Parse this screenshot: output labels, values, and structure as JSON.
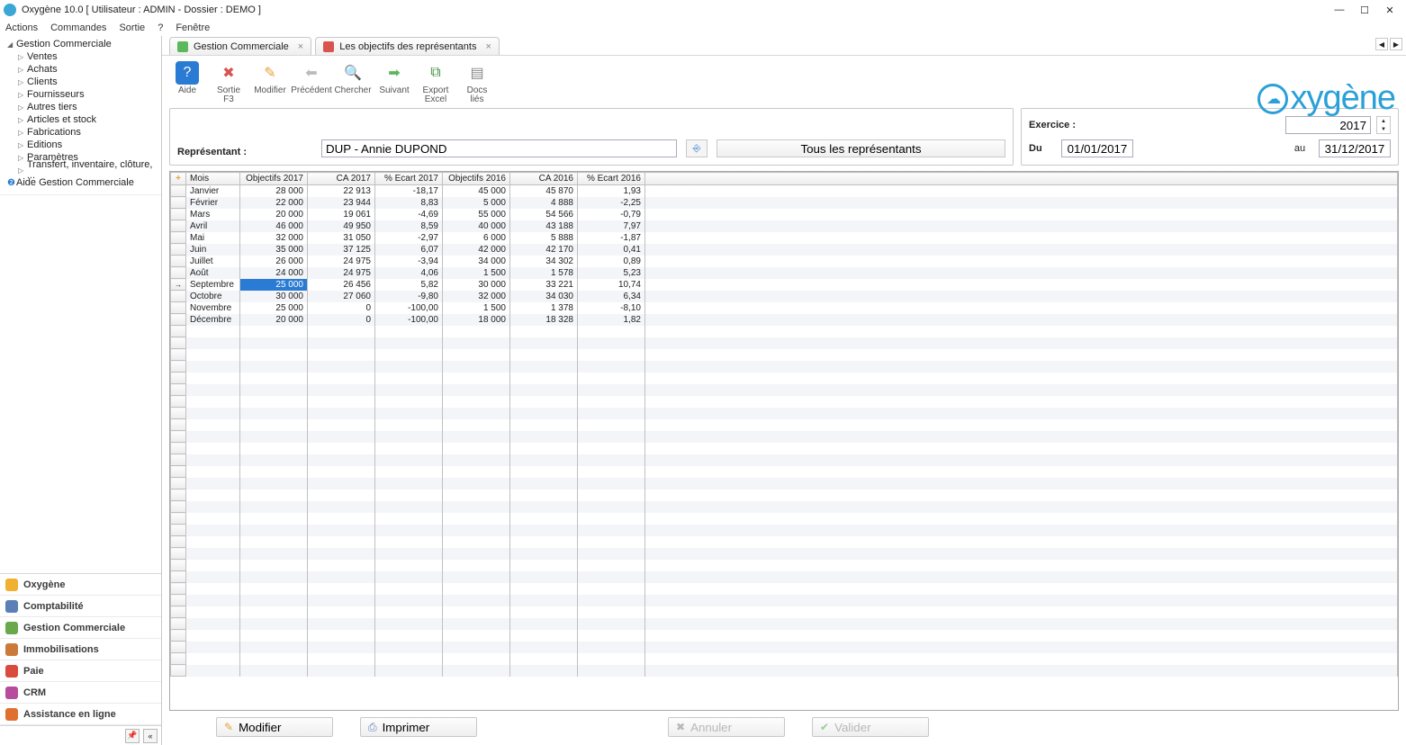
{
  "title": "Oxygène 10.0 [ Utilisateur : ADMIN - Dossier : DEMO ]",
  "menu": [
    "Actions",
    "Commandes",
    "Sortie",
    "?",
    "Fenêtre"
  ],
  "tree": {
    "root": "Gestion Commerciale",
    "items": [
      "Ventes",
      "Achats",
      "Clients",
      "Fournisseurs",
      "Autres tiers",
      "Articles et stock",
      "Fabrications",
      "Editions",
      "Paramètres",
      "Transfert, inventaire, clôture, ..."
    ],
    "help": "Aide Gestion Commerciale"
  },
  "modules": [
    "Oxygène",
    "Comptabilité",
    "Gestion Commerciale",
    "Immobilisations",
    "Paie",
    "CRM",
    "Assistance en ligne"
  ],
  "tabs": {
    "t1": "Gestion Commerciale",
    "t2": "Les objectifs des représentants"
  },
  "toolbar": {
    "aide": "Aide",
    "sortie": "Sortie\nF3",
    "modifier": "Modifier",
    "precedent": "Précédent",
    "chercher": "Chercher",
    "suivant": "Suivant",
    "excel": "Export\nExcel",
    "docs": "Docs\nliés"
  },
  "logo": "xygène",
  "filters": {
    "rep_label": "Représentant :",
    "rep_value": "DUP - Annie DUPOND",
    "all_reps": "Tous les représentants",
    "exercice_label": "Exercice :",
    "exercice_value": "2017",
    "from_label": "Du",
    "from_value": "01/01/2017",
    "to_label": "au",
    "to_value": "31/12/2017"
  },
  "grid": {
    "headers": [
      "Mois",
      "Objectifs 2017",
      "CA 2017",
      "% Ecart 2017",
      "Objectifs 2016",
      "CA 2016",
      "% Ecart 2016"
    ],
    "rows": [
      {
        "m": "Janvier",
        "o17": "28 000",
        "c17": "22 913",
        "e17": "-18,17",
        "o16": "45 000",
        "c16": "45 870",
        "e16": "1,93",
        "sel": false,
        "mark": ""
      },
      {
        "m": "Février",
        "o17": "22 000",
        "c17": "23 944",
        "e17": "8,83",
        "o16": "5 000",
        "c16": "4 888",
        "e16": "-2,25",
        "sel": false,
        "mark": ""
      },
      {
        "m": "Mars",
        "o17": "20 000",
        "c17": "19 061",
        "e17": "-4,69",
        "o16": "55 000",
        "c16": "54 566",
        "e16": "-0,79",
        "sel": false,
        "mark": ""
      },
      {
        "m": "Avril",
        "o17": "46 000",
        "c17": "49 950",
        "e17": "8,59",
        "o16": "40 000",
        "c16": "43 188",
        "e16": "7,97",
        "sel": false,
        "mark": ""
      },
      {
        "m": "Mai",
        "o17": "32 000",
        "c17": "31 050",
        "e17": "-2,97",
        "o16": "6 000",
        "c16": "5 888",
        "e16": "-1,87",
        "sel": false,
        "mark": ""
      },
      {
        "m": "Juin",
        "o17": "35 000",
        "c17": "37 125",
        "e17": "6,07",
        "o16": "42 000",
        "c16": "42 170",
        "e16": "0,41",
        "sel": false,
        "mark": ""
      },
      {
        "m": "Juillet",
        "o17": "26 000",
        "c17": "24 975",
        "e17": "-3,94",
        "o16": "34 000",
        "c16": "34 302",
        "e16": "0,89",
        "sel": false,
        "mark": ""
      },
      {
        "m": "Août",
        "o17": "24 000",
        "c17": "24 975",
        "e17": "4,06",
        "o16": "1 500",
        "c16": "1 578",
        "e16": "5,23",
        "sel": false,
        "mark": ""
      },
      {
        "m": "Septembre",
        "o17": "25 000",
        "c17": "26 456",
        "e17": "5,82",
        "o16": "30 000",
        "c16": "33 221",
        "e16": "10,74",
        "sel": true,
        "mark": "→"
      },
      {
        "m": "Octobre",
        "o17": "30 000",
        "c17": "27 060",
        "e17": "-9,80",
        "o16": "32 000",
        "c16": "34 030",
        "e16": "6,34",
        "sel": false,
        "mark": ""
      },
      {
        "m": "Novembre",
        "o17": "25 000",
        "c17": "0",
        "e17": "-100,00",
        "o16": "1 500",
        "c16": "1 378",
        "e16": "-8,10",
        "sel": false,
        "mark": ""
      },
      {
        "m": "Décembre",
        "o17": "20 000",
        "c17": "0",
        "e17": "-100,00",
        "o16": "18 000",
        "c16": "18 328",
        "e16": "1,82",
        "sel": false,
        "mark": ""
      }
    ]
  },
  "bottom": {
    "modifier": "Modifier",
    "imprimer": "Imprimer",
    "annuler": "Annuler",
    "valider": "Valider"
  }
}
